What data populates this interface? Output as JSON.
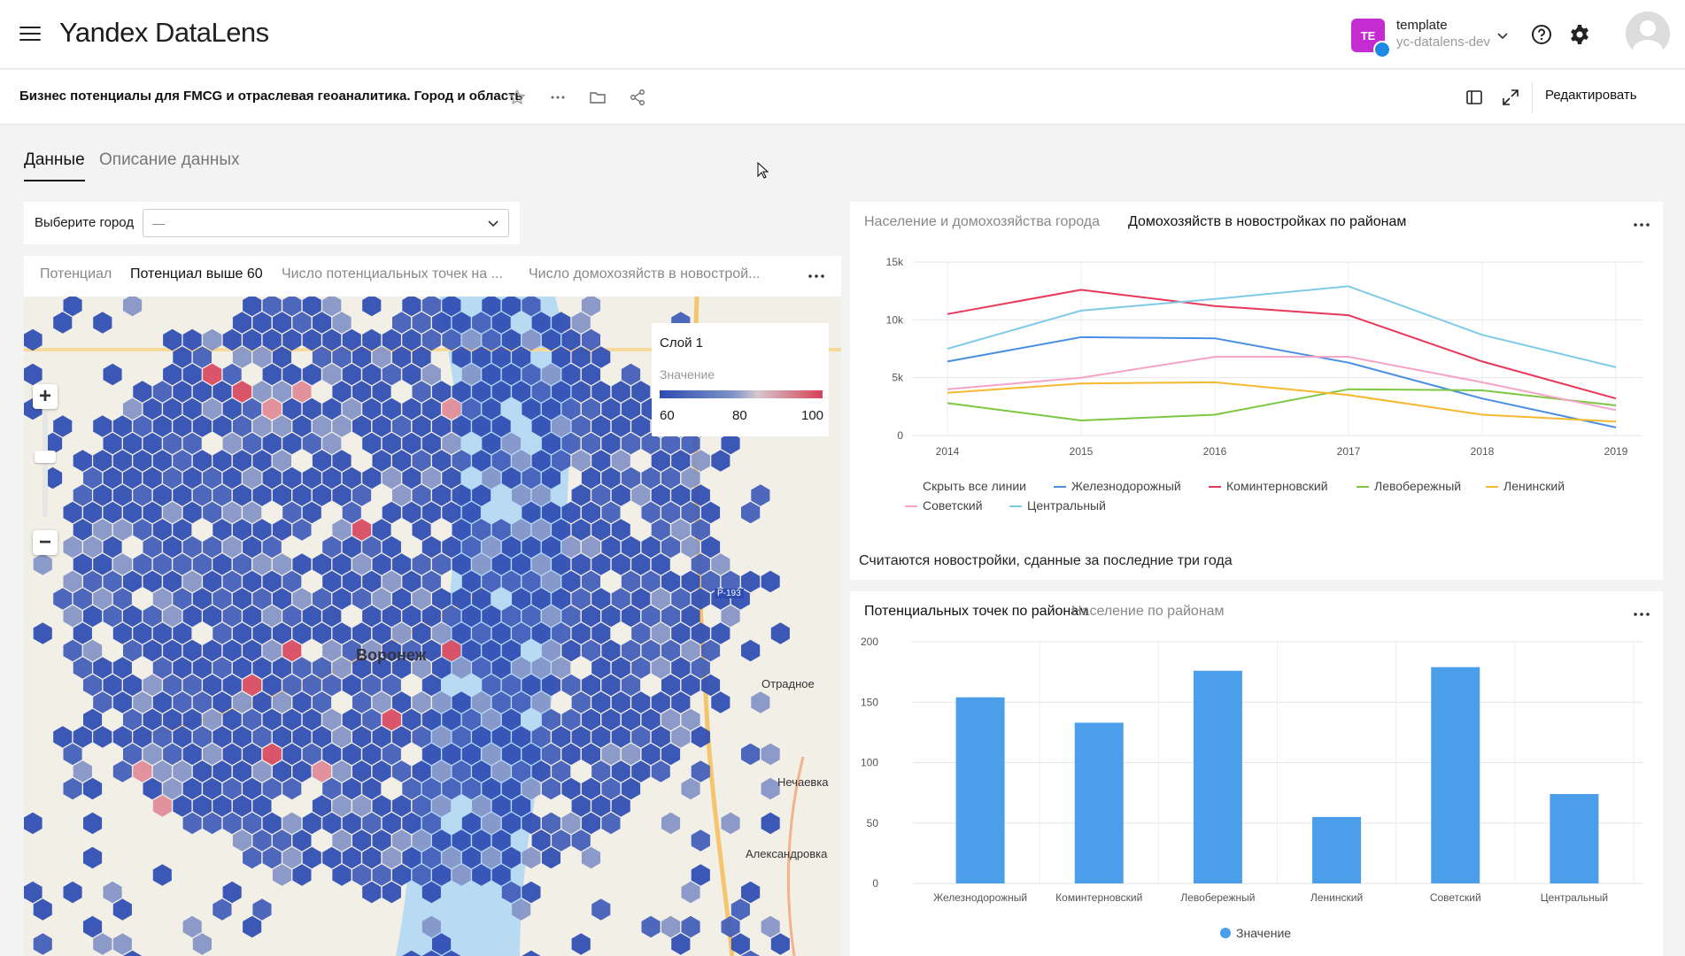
{
  "app": {
    "logo_brand": "Yandex",
    "logo_product": "DataLens"
  },
  "account": {
    "initials": "TE",
    "name": "template",
    "org": "yc-datalens-dev",
    "color": "#c42bd0"
  },
  "dashboard": {
    "title": "Бизнес потенциалы для FMCG и отраслевая геоаналитика. Город и область",
    "edit_label": "Редактировать"
  },
  "tabs": [
    {
      "label": "Данные",
      "active": true
    },
    {
      "label": "Описание данных",
      "active": false
    }
  ],
  "selector": {
    "label": "Выберите город",
    "value": "—"
  },
  "map_card": {
    "tabs": [
      {
        "label": "Потенциал",
        "active": false
      },
      {
        "label": "Потенциал выше 60",
        "active": true
      },
      {
        "label": "Число потенциальных точек на ...",
        "active": false
      },
      {
        "label": "Число домохозяйств в новострой...",
        "active": false
      }
    ],
    "legend": {
      "title": "Слой 1",
      "subtitle": "Значение",
      "min": "60",
      "mid": "80",
      "max": "100"
    },
    "labels": [
      {
        "text": "Воронеж",
        "key": "voronezh"
      },
      {
        "text": "Отрадное",
        "key": "otradnoe"
      },
      {
        "text": "Нечаевка",
        "key": "nechaevka"
      },
      {
        "text": "Александровка",
        "key": "aleksandrovka"
      }
    ],
    "road_label": "Р-193"
  },
  "line_card": {
    "tabs": [
      {
        "label": "Население и домохозяйства города",
        "active": false
      },
      {
        "label": "Домохозяйств в новостройках по районам",
        "active": true
      }
    ],
    "legend_toggle": "Скрыть все линии",
    "note": "Считаются новостройки, сданные за последние три года"
  },
  "bar_card": {
    "tabs": [
      {
        "label": "Потенциальных точек по районам",
        "active": true
      },
      {
        "label": "Население по районам",
        "active": false
      }
    ]
  },
  "chart_data": [
    {
      "type": "line",
      "x": [
        2014,
        2015,
        2016,
        2017,
        2018,
        2019
      ],
      "ylim": [
        0,
        15000
      ],
      "yticks": [
        "0",
        "5k",
        "10k",
        "15k"
      ],
      "series": [
        {
          "name": "Железнодорожный",
          "color": "#4a90e2",
          "values": [
            6400,
            8500,
            8400,
            6300,
            3200,
            700
          ]
        },
        {
          "name": "Коминтерновский",
          "color": "#e8385a",
          "values": [
            10500,
            12600,
            11200,
            10400,
            6400,
            3200
          ]
        },
        {
          "name": "Левобережный",
          "color": "#7cc742",
          "values": [
            2800,
            1300,
            1800,
            4000,
            3900,
            2600
          ]
        },
        {
          "name": "Ленинский",
          "color": "#f5b82e",
          "values": [
            3700,
            4500,
            4600,
            3500,
            1800,
            1200
          ]
        },
        {
          "name": "Советский",
          "color": "#f5a3c7",
          "values": [
            4000,
            5000,
            6800,
            6800,
            4600,
            2200
          ]
        },
        {
          "name": "Центральный",
          "color": "#7ecbe8",
          "values": [
            7500,
            10800,
            11800,
            12900,
            8700,
            5900
          ]
        }
      ]
    },
    {
      "type": "bar",
      "categories": [
        "Железнодорожный",
        "Коминтерновский",
        "Левобережный",
        "Ленинский",
        "Советский",
        "Центральный"
      ],
      "values": [
        154,
        133,
        176,
        55,
        179,
        74
      ],
      "ylim": [
        0,
        200
      ],
      "yticks": [
        "0",
        "50",
        "100",
        "150",
        "200"
      ],
      "legend": "Значение",
      "color": "#4a9eea"
    }
  ]
}
